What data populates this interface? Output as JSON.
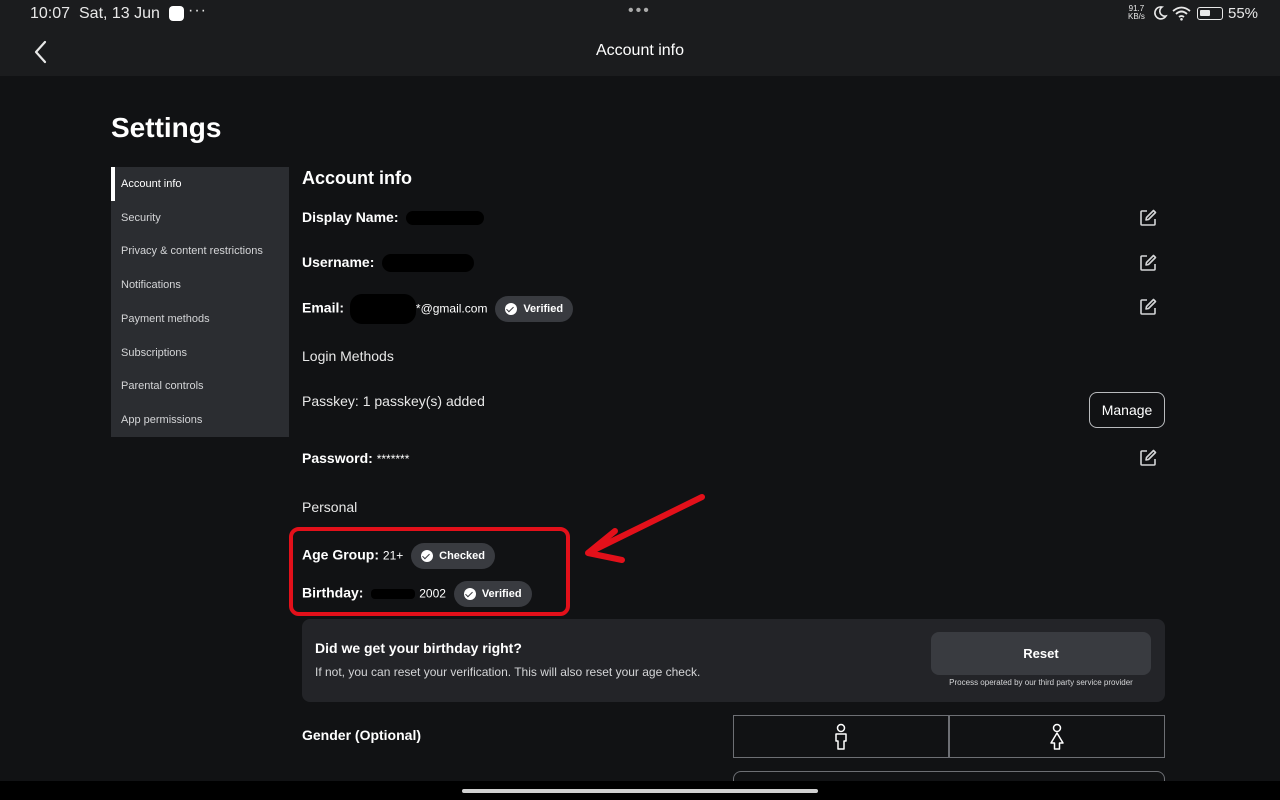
{
  "status_bar": {
    "time": "10:07",
    "date": "Sat, 13 Jun",
    "more": "···",
    "center_dots": "•••",
    "speed_value": "91.7",
    "speed_unit": "KB/s",
    "battery": "55%",
    "battery_level": 0.55
  },
  "header": {
    "title": "Account info"
  },
  "page": {
    "title": "Settings"
  },
  "sidebar": {
    "items": [
      {
        "label": "Account info",
        "active": true
      },
      {
        "label": "Security"
      },
      {
        "label": "Privacy & content restrictions"
      },
      {
        "label": "Notifications"
      },
      {
        "label": "Payment methods"
      },
      {
        "label": "Subscriptions"
      },
      {
        "label": "Parental controls"
      },
      {
        "label": "App permissions"
      }
    ]
  },
  "account": {
    "section_title": "Account info",
    "display_name_label": "Display Name:",
    "username_label": "Username:",
    "email_label": "Email:",
    "email_suffix": "*@gmail.com",
    "email_badge": "Verified",
    "login_methods_label": "Login Methods",
    "passkey_text": "Passkey: 1 passkey(s) added",
    "manage_label": "Manage",
    "password_label": "Password:",
    "password_value": "*******",
    "personal_label": "Personal",
    "age_group_label": "Age Group:",
    "age_group_value": "21+",
    "age_badge": "Checked",
    "birthday_label": "Birthday:",
    "birthday_year": "2002",
    "birthday_badge": "Verified"
  },
  "birthday_card": {
    "question": "Did we get your birthday right?",
    "description": "If not, you can reset your verification. This will also reset your age check.",
    "reset_label": "Reset",
    "note": "Process operated by our third party service provider"
  },
  "gender": {
    "label": "Gender (Optional)"
  },
  "colors": {
    "highlight": "#e3101a",
    "background": "#111214",
    "sidebar": "#2b2d31"
  }
}
